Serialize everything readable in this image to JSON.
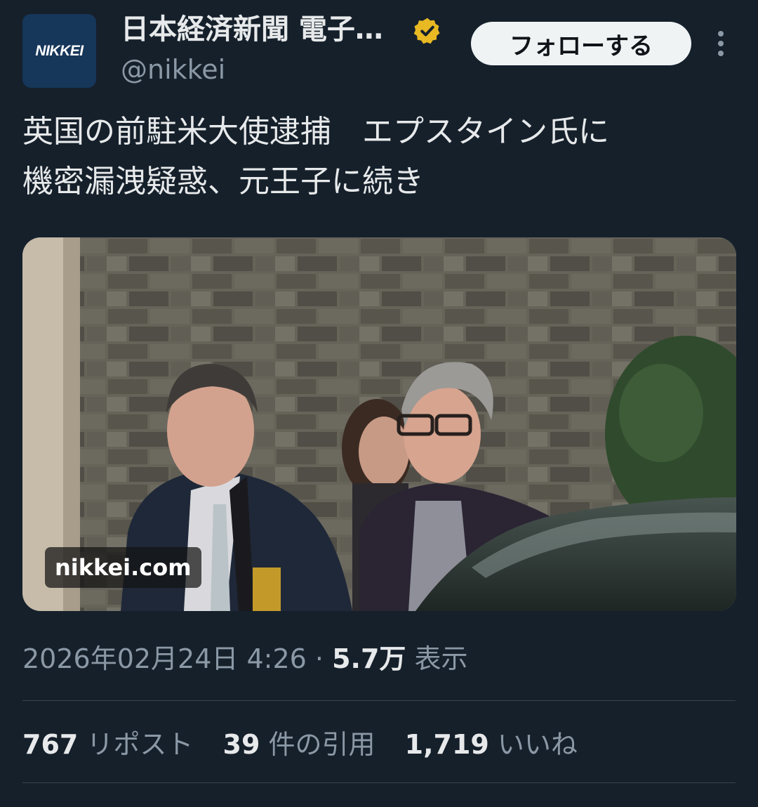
{
  "header": {
    "avatar_text": "NIKKEI",
    "display_name": "日本経済新聞 電子…",
    "handle": "@nikkei",
    "follow_label": "フォローする",
    "verified_color": "#e8b923"
  },
  "tweet": {
    "text": "英国の前駐米大使逮捕　エプスタイン氏に\n機密漏洩疑惑、元王子に続き"
  },
  "media": {
    "source_badge": "nikkei.com"
  },
  "meta": {
    "datetime": "2026年02月24日 4:26",
    "separator": "·",
    "views_count": "5.7万",
    "views_label": "表示"
  },
  "stats": {
    "reposts_count": "767",
    "reposts_label": "リポスト",
    "quotes_count": "39",
    "quotes_label": "件の引用",
    "likes_count": "1,719",
    "likes_label": "いいね"
  }
}
